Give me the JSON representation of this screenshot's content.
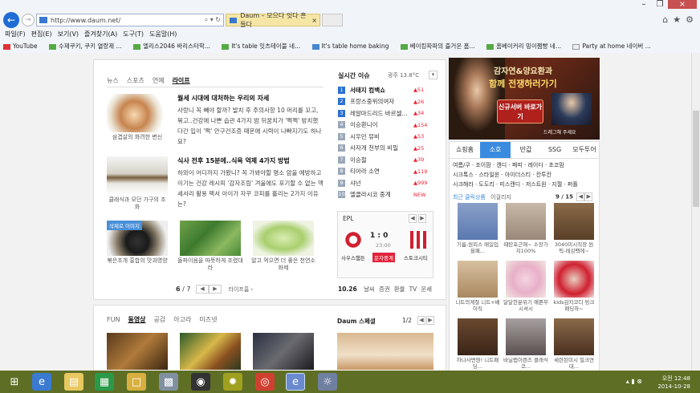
{
  "browser": {
    "url": "http://www.daum.net/",
    "tab_title": "Daum – 모으다 잇다 흔들다",
    "menu": [
      "파일(F)",
      "편집(E)",
      "보기(V)",
      "즐겨찾기(A)",
      "도구(T)",
      "도움말(H)"
    ],
    "favorites": [
      "YouTube",
      "수제쿠키, 쿠키 열랑제 ...",
      "엘리스2046 바리스타학...",
      "It's table 잇츠테이블 네...",
      "It's table home baking",
      "베이킹파파의 즐거운 홈...",
      "홈베이커리 밍이쩜빵 네...",
      "Party at home 네이버 ..."
    ]
  },
  "main": {
    "tabs": [
      "뉴스",
      "스포츠",
      "연예",
      "라이프"
    ],
    "articles": [
      {
        "caption": "삼겹살의 화려한 변신",
        "title": "월세 시대에 대처하는 우리의 자세",
        "body": "사랑니 꼭 빼야 할까? 발치 후 주의사항 10 머리를 꼬고, 볶고..건강에 나쁜 습관 4가지 밤 뒤꿈치가 '쩍쩍' 방치했다간 입이 '쩍' 안구건조증 때문에 시력이 나빠지기도 하나요?"
      },
      {
        "caption": "클래식과 모던 가구의 조화",
        "title": "식사 전후 15분에..식욕 억제 4가지 방법",
        "body": "하와이 어디까지 가봤니? 꼭 가봐야할 명소 암을 예방하고 이기는 건강 레시피 '감자조림' 겨울에도 포기할 수 없는 액세서리 활용 팩서 아이가 자꾸 코피를 흘리는 2가지 이유는?"
      }
    ],
    "pictures": [
      {
        "badge": "삭제로 이미지",
        "caption": "볶은조개 홍합의 맛과영양"
      },
      {
        "caption": "돌파이음을 따뜻하게 조렸대라"
      },
      {
        "caption": "알고 먹으면 더 좋은 천연소화제"
      }
    ],
    "pager": {
      "current": "6",
      "total": "7",
      "more": "라이프홈 ›"
    }
  },
  "realtime": {
    "title": "실시간 이슈",
    "weather": "광주 13.8°C",
    "items": [
      {
        "rank": "1",
        "text": "서태지 컴백쇼",
        "change": "51"
      },
      {
        "rank": "2",
        "text": "프랑스중위의여자",
        "change": "26"
      },
      {
        "rank": "3",
        "text": "레알마드리드 바르셀...",
        "change": "34"
      },
      {
        "rank": "4",
        "text": "이승환니이",
        "change": "154"
      },
      {
        "rank": "5",
        "text": "시우민 뮤비",
        "change": "53"
      },
      {
        "rank": "6",
        "text": "사자개 천부의 비밀",
        "change": "25"
      },
      {
        "rank": "7",
        "text": "이승철",
        "change": "39"
      },
      {
        "rank": "8",
        "text": "티아라 소연",
        "change": "119"
      },
      {
        "rank": "9",
        "text": "샤넌",
        "change": "999"
      },
      {
        "rank": "10",
        "text": "엘클라시코 중계",
        "change": "NEW"
      }
    ]
  },
  "epl": {
    "label": "EPL",
    "score": "1 : 0",
    "time": "23:00",
    "home": "사우스햄튼",
    "away": "스토크시티",
    "status": "문자중계"
  },
  "datebar": {
    "date": "10.26",
    "items": [
      "날씨",
      "증권",
      "환율",
      "TV",
      "운세"
    ]
  },
  "lower": {
    "tabs": [
      "FUN",
      "동영상",
      "공감",
      "아고라",
      "미즈넷"
    ],
    "special": "Daum 스페셜",
    "pager": "1/2"
  },
  "ad": {
    "headline": "감자연&양요환과",
    "highlight": "함께 전쟁하러가기",
    "button": "신규서버 바로가기",
    "note": "드레그해 주세요"
  },
  "shopping": {
    "tabs": [
      "쇼핑홈",
      "소호",
      "반값",
      "SSG",
      "모두투어"
    ],
    "categories": [
      "여름/쿠 · 조이팜 · 캔디 · 패피 · 레이다 · 초코맘",
      "시크톡스 · 스타일윈 · 아이더스티 · 칸투칸",
      "시크해라 · 도도리 · 미스캔디 · 저스트원 · 지젤 · 퍼플"
    ],
    "recent": "최근 클릭상품",
    "similar": "이걸리지",
    "page": "9 / 15",
    "products": [
      "기름-원피스 매일입을패...",
      "때탄포근해~ 소장가치100%",
      "3040미시직장 원픽-레깅팩에~",
      "니트의계절 니트+베이직",
      "달달한분위기 예쁜무시셔시",
      "kids감지코디 밍크패딩하~",
      "하나사면뭔! 니트패딩...",
      "바닐랩이렌즈 클래식 코...",
      "세련된미시 밀크연대..."
    ]
  },
  "taskbar": {
    "time": "오전 12:48",
    "date": "2014-10-28"
  }
}
